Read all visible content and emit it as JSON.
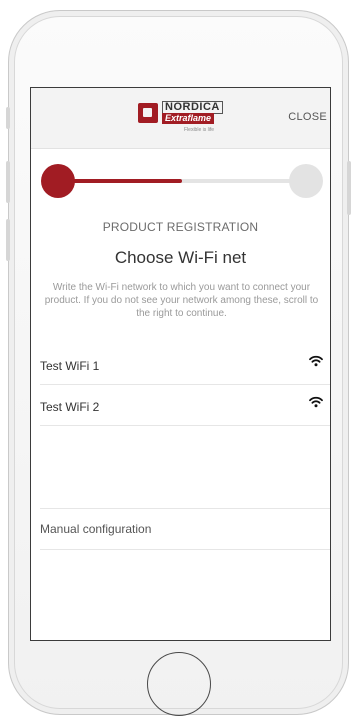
{
  "header": {
    "logo_brand": "NORDICA",
    "logo_sub": "Extraflame",
    "logo_tagline": "Flexible is life",
    "close_label": "CLOSE"
  },
  "stepper": {
    "progress": 0.5,
    "steps_total": 2,
    "current_step": 1
  },
  "main": {
    "section_label": "PRODUCT REGISTRATION",
    "title": "Choose Wi-Fi net",
    "description": "Write the Wi-Fi network to which you want to connect your product. If you do not see your network among these, scroll to the right to continue."
  },
  "networks": [
    {
      "name": "Test WiFi 1",
      "icon": "wifi-icon"
    },
    {
      "name": "Test WiFi 2",
      "icon": "wifi-icon"
    }
  ],
  "manual": {
    "label": "Manual configuration"
  },
  "colors": {
    "accent": "#a11c23",
    "track": "#e4e4e4",
    "text": "#333333",
    "muted": "#9a9a9a"
  }
}
